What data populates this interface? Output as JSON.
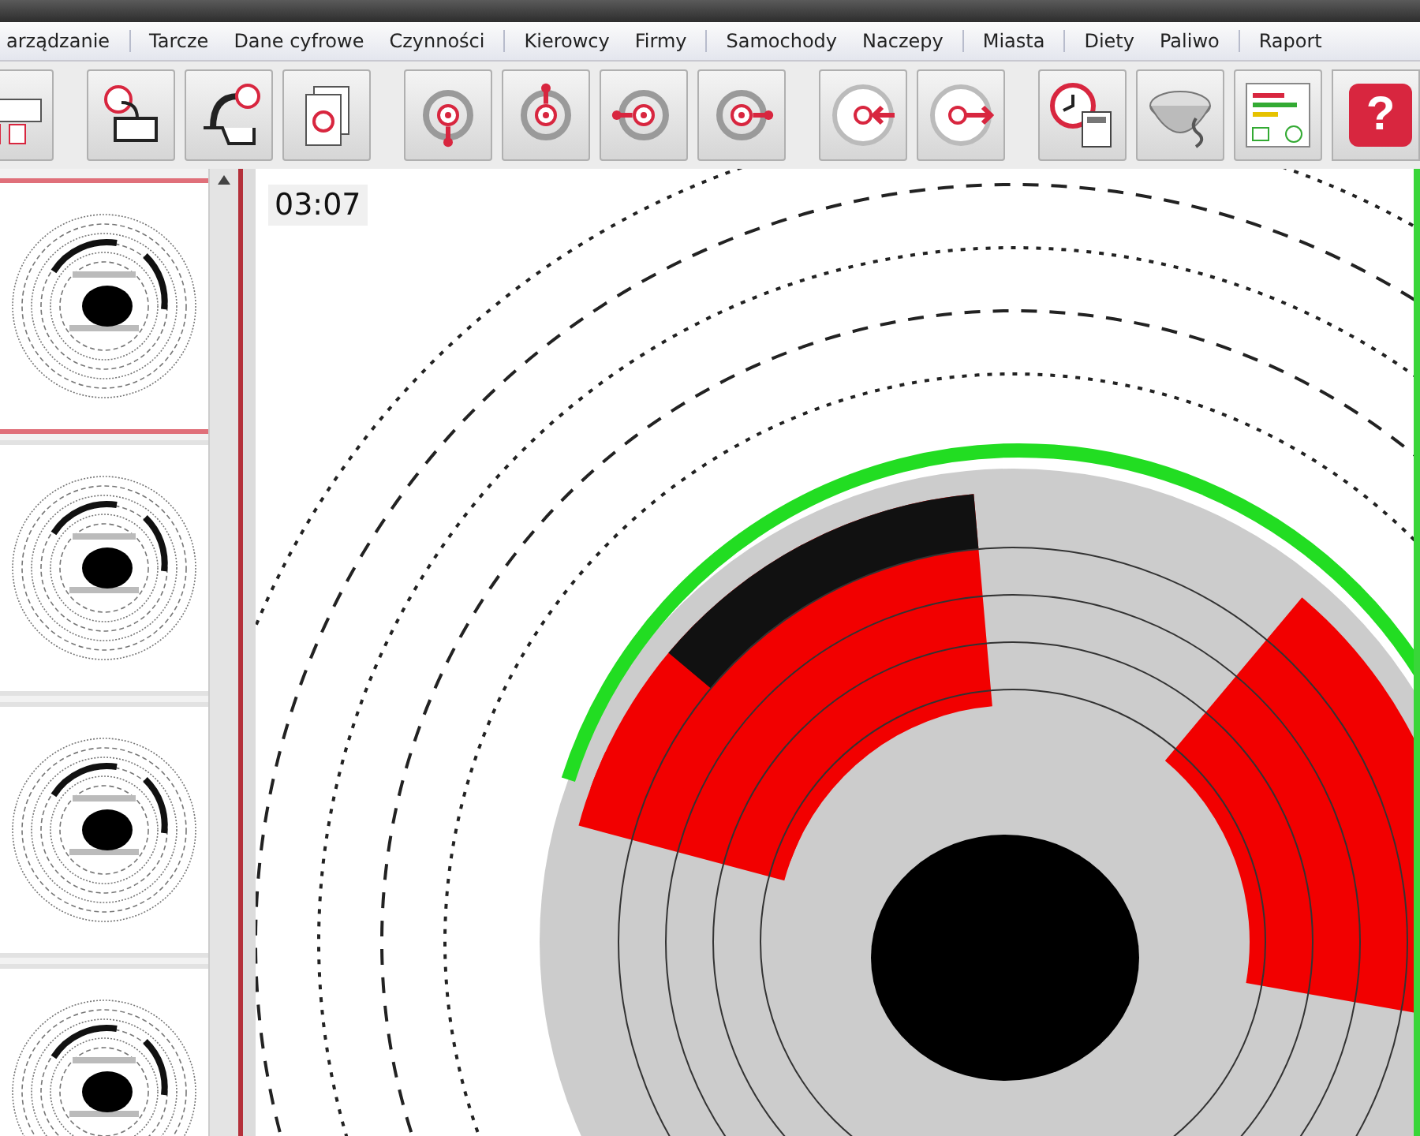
{
  "menu": [
    {
      "label": "arządzanie"
    },
    {
      "label": "Tarcze"
    },
    {
      "label": "Dane cyfrowe"
    },
    {
      "label": "Czynności"
    },
    {
      "label": "Kierowcy"
    },
    {
      "label": "Firmy"
    },
    {
      "label": "Samochody"
    },
    {
      "label": "Naczepy"
    },
    {
      "label": "Miasta"
    },
    {
      "label": "Diety"
    },
    {
      "label": "Paliwo"
    },
    {
      "label": "Raport"
    }
  ],
  "toolbar": [
    {
      "kind": "printer"
    },
    {
      "kind": "scan"
    },
    {
      "kind": "import"
    },
    {
      "kind": "documents"
    },
    {
      "kind": "disc-down"
    },
    {
      "kind": "disc-up"
    },
    {
      "kind": "disc-left"
    },
    {
      "kind": "disc-right"
    },
    {
      "kind": "target-left"
    },
    {
      "kind": "target-right"
    },
    {
      "kind": "clock-calculator"
    },
    {
      "kind": "bowl-paragraph"
    },
    {
      "kind": "chart-panel"
    },
    {
      "kind": "help",
      "label": "?"
    }
  ],
  "thumbnails": [
    {
      "selected": true
    },
    {
      "selected": false
    },
    {
      "selected": false
    },
    {
      "selected": false
    }
  ],
  "viewer": {
    "time": "03:07"
  }
}
